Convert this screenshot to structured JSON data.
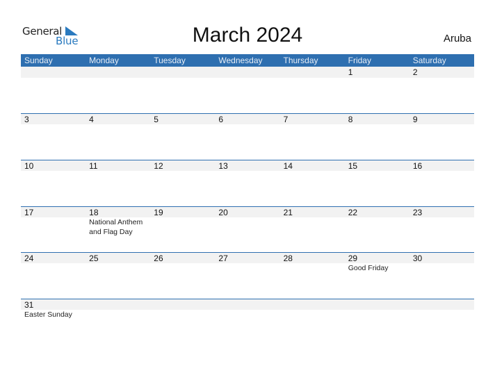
{
  "logo": {
    "general": "General",
    "blue": "Blue"
  },
  "title": "March 2024",
  "country": "Aruba",
  "colors": {
    "accent": "#2e6fb0",
    "strip": "#f2f2f2"
  },
  "weekdays": [
    "Sunday",
    "Monday",
    "Tuesday",
    "Wednesday",
    "Thursday",
    "Friday",
    "Saturday"
  ],
  "weeks": [
    [
      {
        "day": ""
      },
      {
        "day": ""
      },
      {
        "day": ""
      },
      {
        "day": ""
      },
      {
        "day": ""
      },
      {
        "day": "1"
      },
      {
        "day": "2"
      }
    ],
    [
      {
        "day": "3"
      },
      {
        "day": "4"
      },
      {
        "day": "5"
      },
      {
        "day": "6"
      },
      {
        "day": "7"
      },
      {
        "day": "8"
      },
      {
        "day": "9"
      }
    ],
    [
      {
        "day": "10"
      },
      {
        "day": "11"
      },
      {
        "day": "12"
      },
      {
        "day": "13"
      },
      {
        "day": "14"
      },
      {
        "day": "15"
      },
      {
        "day": "16"
      }
    ],
    [
      {
        "day": "17"
      },
      {
        "day": "18",
        "event": "National Anthem and Flag Day"
      },
      {
        "day": "19"
      },
      {
        "day": "20"
      },
      {
        "day": "21"
      },
      {
        "day": "22"
      },
      {
        "day": "23"
      }
    ],
    [
      {
        "day": "24"
      },
      {
        "day": "25"
      },
      {
        "day": "26"
      },
      {
        "day": "27"
      },
      {
        "day": "28"
      },
      {
        "day": "29",
        "event": "Good Friday"
      },
      {
        "day": "30"
      }
    ],
    [
      {
        "day": "31",
        "event": "Easter Sunday"
      },
      {
        "day": ""
      },
      {
        "day": ""
      },
      {
        "day": ""
      },
      {
        "day": ""
      },
      {
        "day": ""
      },
      {
        "day": ""
      }
    ]
  ]
}
